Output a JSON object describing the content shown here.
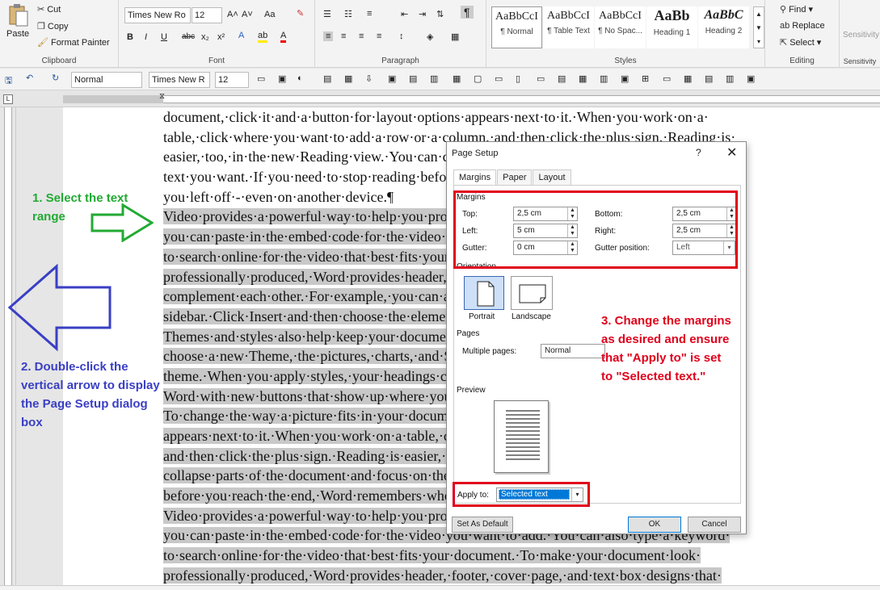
{
  "ribbon": {
    "clipboard": {
      "paste": "Paste",
      "cut": "Cut",
      "copy": "Copy",
      "format_painter": "Format Painter",
      "label": "Clipboard"
    },
    "font": {
      "family": "Times New Ro",
      "size": "12",
      "label": "Font",
      "grow": "A˄",
      "shrink": "A˅",
      "case": "Aa",
      "bold": "B",
      "italic": "I",
      "underline": "U",
      "strike": "abc",
      "sub": "x₂",
      "sup": "x²"
    },
    "paragraph": {
      "label": "Paragraph",
      "pilcrow": "¶"
    },
    "styles": {
      "label": "Styles",
      "items": [
        {
          "sample": "AaBbCcI",
          "name": "¶ Normal"
        },
        {
          "sample": "AaBbCcI",
          "name": "¶ Table Text"
        },
        {
          "sample": "AaBbCcI",
          "name": "¶ No Spac..."
        },
        {
          "sample": "AaBb",
          "name": "Heading 1"
        },
        {
          "sample": "AaBbC",
          "name": "Heading 2"
        }
      ]
    },
    "editing": {
      "label": "Editing",
      "find": "Find",
      "replace": "Replace",
      "select": "Select"
    },
    "sensitivity": {
      "label": "Sensitivity",
      "button": "Sensitivity"
    }
  },
  "qat": {
    "style": "Normal",
    "font": "Times New R",
    "size": "12"
  },
  "document": {
    "lines": [
      {
        "text": "document,·click·it·and·a·button·for·layout·options·appears·next·to·it.·When·you·work·on·a·",
        "sel": false
      },
      {
        "text": "table,·click·where·you·want·to·add·a·row·or·a·column,·and·then·click·the·plus·sign.·Reading·is·",
        "sel": false
      },
      {
        "text": "easier,·too,·in·the·new·Reading·view.·You·can·collapse·parts·of·the·document·and·focus·on·the·",
        "sel": false
      },
      {
        "text": "text·you·want.·If·you·need·to·stop·reading·before·you·reach·the·end,·Word·remembers·where·",
        "sel": false
      },
      {
        "text": "you·left·off·-·even·on·another·device.¶",
        "sel": false
      },
      {
        "text": "Video·provides·a·powerful·way·to·help·you·prove·your·point.·When·you·click·Online·Video,·",
        "sel": true
      },
      {
        "text": "you·can·paste·in·the·embed·code·for·the·video·you·want·to·add.·You·can·also·type·a·keyword·",
        "sel": true
      },
      {
        "text": "to·search·online·for·the·video·that·best·fits·your·document.·To·make·your·document·look·",
        "sel": true
      },
      {
        "text": "professionally·produced,·Word·provides·header,·footer,·cover·page,·and·text·box·designs·that·",
        "sel": true
      },
      {
        "text": "complement·each·other.·For·example,·you·can·add·a·matching·cover·page,·header,·and·",
        "sel": true
      },
      {
        "text": "sidebar.·Click·Insert·and·then·choose·the·elements·you·want·from·the·different·galleries.·",
        "sel": true
      },
      {
        "text": "Themes·and·styles·also·help·keep·your·document·coordinated.·When·you·click·Design·and·",
        "sel": true
      },
      {
        "text": "choose·a·new·Theme,·the·pictures,·charts,·and·SmartArt·graphics·change·to·match·your·new·",
        "sel": true
      },
      {
        "text": "theme.·When·you·apply·styles,·your·headings·change·to·match·the·new·theme.·Save·time·in·",
        "sel": true
      },
      {
        "text": "Word·with·new·buttons·that·show·up·where·you·need·them.·",
        "sel": true
      },
      {
        "text": "To·change·the·way·a·picture·fits·in·your·document,·click·it·and·a·button·for·layout·options·",
        "sel": true
      },
      {
        "text": "appears·next·to·it.·When·you·work·on·a·table,·click·where·you·want·to·add·a·row·or·a·column,·",
        "sel": true
      },
      {
        "text": "and·then·click·the·plus·sign.·Reading·is·easier,·too,·in·the·new·Reading·view.·You·can·",
        "sel": true
      },
      {
        "text": "collapse·parts·of·the·document·and·focus·on·the·text·you·want.·If·you·need·to·stop·reading·",
        "sel": true
      },
      {
        "text": "before·you·reach·the·end,·Word·remembers·where·you·left·off·-·even·on·another·device.·",
        "sel": true
      },
      {
        "text": "Video·provides·a·powerful·way·to·help·you·prove·your·point.·When·you·click·Online·Video,·",
        "sel": true
      },
      {
        "text": "you·can·paste·in·the·embed·code·for·the·video·you·want·to·add.·You·can·also·type·a·keyword·",
        "sel": true
      },
      {
        "text": "to·search·online·for·the·video·that·best·fits·your·document.·To·make·your·document·look·",
        "sel": true
      },
      {
        "text": "professionally·produced,·Word·provides·header,·footer,·cover·page,·and·text·box·designs·that·",
        "sel": true
      }
    ]
  },
  "annotations": {
    "step1": "1. Select the text range",
    "step2": "2. Double-click the vertical arrow to display the Page Setup dialog box",
    "step3": "3. Change the margins as desired and ensure that \"Apply to\" is set to \"Selected text.\"",
    "colors": {
      "step1": "#22aa33",
      "step2": "#3a3fc4",
      "step3": "#e0001b"
    }
  },
  "dialog": {
    "title": "Page Setup",
    "help": "?",
    "close": "✕",
    "tabs": [
      "Margins",
      "Paper",
      "Layout"
    ],
    "margins_label": "Margins",
    "top_label": "Top:",
    "top_value": "2,5 cm",
    "bottom_label": "Bottom:",
    "bottom_value": "2,5 cm",
    "left_label": "Left:",
    "left_value": "5 cm",
    "right_label": "Right:",
    "right_value": "2,5 cm",
    "gutter_label": "Gutter:",
    "gutter_value": "0 cm",
    "gutter_pos_label": "Gutter position:",
    "gutter_pos_value": "Left",
    "orientation_label": "Orientation",
    "portrait": "Portrait",
    "landscape": "Landscape",
    "pages_label": "Pages",
    "multiple_pages_label": "Multiple pages:",
    "multiple_pages_value": "Normal",
    "preview_label": "Preview",
    "apply_to_label": "Apply to:",
    "apply_to_value": "Selected text",
    "set_default": "Set As Default",
    "ok": "OK",
    "cancel": "Cancel"
  }
}
